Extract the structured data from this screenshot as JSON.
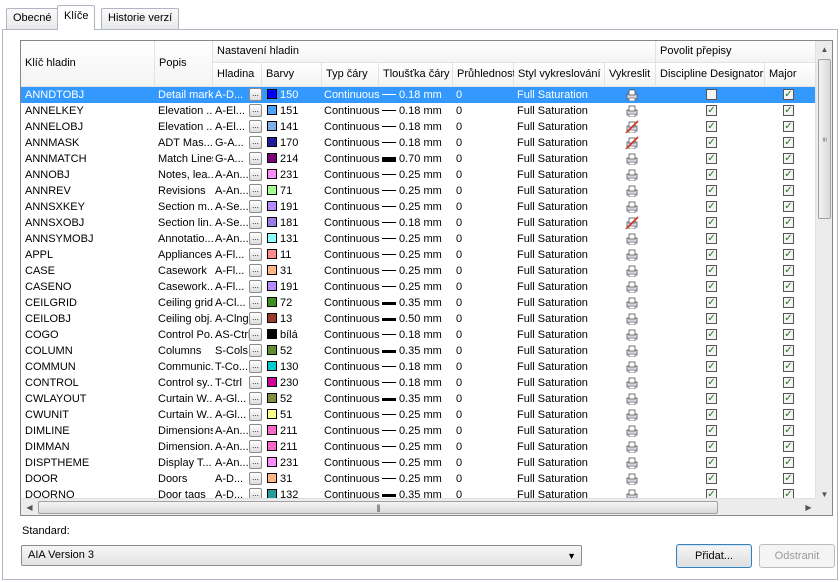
{
  "tabs": [
    "Obecné",
    "Klíče",
    "Historie verzí"
  ],
  "headers": {
    "klic": "Klíč hladin",
    "popis": "Popis",
    "nastaveni": "Nastavení hladin",
    "hladina": "Hladina",
    "barvy": "Barvy",
    "typ": "Typ čáry",
    "tloustka": "Tloušťka čáry",
    "pruhlednost": "Průhlednost",
    "styl": "Styl vykreslování",
    "vykreslit": "Vykreslit",
    "povolit": "Povolit přepisy",
    "discipline": "Discipline Designator",
    "major": "Major"
  },
  "rows": [
    {
      "key": "ANNDTOBJ",
      "popis": "Detail marks",
      "hladina": "A-D...",
      "color_hex": "#0000ff",
      "color": "150",
      "typ": "Continuous",
      "lw": "0.18 mm",
      "lw_style": "thin",
      "pr": "0",
      "styl": "Full Saturation",
      "plot": "yes",
      "disc": false,
      "major": true
    },
    {
      "key": "ANNELKEY",
      "popis": "Elevation ...",
      "hladina": "A-El...",
      "color_hex": "#4aa3ff",
      "color": "151",
      "typ": "Continuous",
      "lw": "0.18 mm",
      "lw_style": "thin",
      "pr": "0",
      "styl": "Full Saturation",
      "plot": "yes",
      "disc": true,
      "major": true
    },
    {
      "key": "ANNELOBJ",
      "popis": "Elevation ...",
      "hladina": "A-El...",
      "color_hex": "#7fb2e6",
      "color": "141",
      "typ": "Continuous",
      "lw": "0.18 mm",
      "lw_style": "thin",
      "pr": "0",
      "styl": "Full Saturation",
      "plot": "no",
      "disc": true,
      "major": true
    },
    {
      "key": "ANNMASK",
      "popis": "ADT Mas...",
      "hladina": "G-A...",
      "color_hex": "#1c1c9c",
      "color": "170",
      "typ": "Continuous",
      "lw": "0.18 mm",
      "lw_style": "thin",
      "pr": "0",
      "styl": "Full Saturation",
      "plot": "no",
      "disc": true,
      "major": true
    },
    {
      "key": "ANNMATCH",
      "popis": "Match Lines",
      "hladina": "G-A...",
      "color_hex": "#7a007a",
      "color": "214",
      "typ": "Continuous",
      "lw": "0.70 mm",
      "lw_style": "thick",
      "pr": "0",
      "styl": "Full Saturation",
      "plot": "yes",
      "disc": true,
      "major": true
    },
    {
      "key": "ANNOBJ",
      "popis": "Notes, lea...",
      "hladina": "A-An...",
      "color_hex": "#ff8cff",
      "color": "231",
      "typ": "Continuous",
      "lw": "0.25 mm",
      "lw_style": "thin",
      "pr": "0",
      "styl": "Full Saturation",
      "plot": "yes",
      "disc": true,
      "major": true
    },
    {
      "key": "ANNREV",
      "popis": "Revisions",
      "hladina": "A-An...",
      "color_hex": "#a8ff8c",
      "color": "71",
      "typ": "Continuous",
      "lw": "0.25 mm",
      "lw_style": "thin",
      "pr": "0",
      "styl": "Full Saturation",
      "plot": "yes",
      "disc": true,
      "major": true
    },
    {
      "key": "ANNSXKEY",
      "popis": "Section m...",
      "hladina": "A-Se...",
      "color_hex": "#b58cff",
      "color": "191",
      "typ": "Continuous",
      "lw": "0.25 mm",
      "lw_style": "thin",
      "pr": "0",
      "styl": "Full Saturation",
      "plot": "yes",
      "disc": true,
      "major": true
    },
    {
      "key": "ANNSXOBJ",
      "popis": "Section lin...",
      "hladina": "A-Se...",
      "color_hex": "#9a7ae6",
      "color": "181",
      "typ": "Continuous",
      "lw": "0.18 mm",
      "lw_style": "thin",
      "pr": "0",
      "styl": "Full Saturation",
      "plot": "no",
      "disc": true,
      "major": true
    },
    {
      "key": "ANNSYMOBJ",
      "popis": "Annotatio...",
      "hladina": "A-An...",
      "color_hex": "#8cffff",
      "color": "131",
      "typ": "Continuous",
      "lw": "0.25 mm",
      "lw_style": "thin",
      "pr": "0",
      "styl": "Full Saturation",
      "plot": "yes",
      "disc": true,
      "major": true
    },
    {
      "key": "APPL",
      "popis": "Appliances",
      "hladina": "A-Fl...",
      "color_hex": "#ff8c8c",
      "color": "11",
      "typ": "Continuous",
      "lw": "0.25 mm",
      "lw_style": "thin",
      "pr": "0",
      "styl": "Full Saturation",
      "plot": "yes",
      "disc": true,
      "major": true
    },
    {
      "key": "CASE",
      "popis": "Casework",
      "hladina": "A-Fl...",
      "color_hex": "#ffb48c",
      "color": "31",
      "typ": "Continuous",
      "lw": "0.25 mm",
      "lw_style": "thin",
      "pr": "0",
      "styl": "Full Saturation",
      "plot": "yes",
      "disc": true,
      "major": true
    },
    {
      "key": "CASENO",
      "popis": "Casework...",
      "hladina": "A-Fl...",
      "color_hex": "#b58cff",
      "color": "191",
      "typ": "Continuous",
      "lw": "0.25 mm",
      "lw_style": "thin",
      "pr": "0",
      "styl": "Full Saturation",
      "plot": "yes",
      "disc": true,
      "major": true
    },
    {
      "key": "CEILGRID",
      "popis": "Ceiling grids",
      "hladina": "A-Cl...",
      "color_hex": "#3f8f1f",
      "color": "72",
      "typ": "Continuous",
      "lw": "0.35 mm",
      "lw_style": "med",
      "pr": "0",
      "styl": "Full Saturation",
      "plot": "yes",
      "disc": true,
      "major": true
    },
    {
      "key": "CEILOBJ",
      "popis": "Ceiling obj...",
      "hladina": "A-Clng",
      "color_hex": "#9c3a2a",
      "color": "13",
      "typ": "Continuous",
      "lw": "0.50 mm",
      "lw_style": "med",
      "pr": "0",
      "styl": "Full Saturation",
      "plot": "yes",
      "disc": true,
      "major": true
    },
    {
      "key": "COGO",
      "popis": "Control Po...",
      "hladina": "AS-Ctrl",
      "color_hex": "#000000",
      "color": "bílá",
      "typ": "Continuous",
      "lw": "0.18 mm",
      "lw_style": "thin",
      "pr": "0",
      "styl": "Full Saturation",
      "plot": "yes",
      "disc": true,
      "major": true
    },
    {
      "key": "COLUMN",
      "popis": "Columns",
      "hladina": "S-Cols",
      "color_hex": "#5f8f2f",
      "color": "52",
      "typ": "Continuous",
      "lw": "0.35 mm",
      "lw_style": "med",
      "pr": "0",
      "styl": "Full Saturation",
      "plot": "yes",
      "disc": true,
      "major": true
    },
    {
      "key": "COMMUN",
      "popis": "Communic...",
      "hladina": "T-Co...",
      "color_hex": "#00cccc",
      "color": "130",
      "typ": "Continuous",
      "lw": "0.18 mm",
      "lw_style": "thin",
      "pr": "0",
      "styl": "Full Saturation",
      "plot": "yes",
      "disc": true,
      "major": true
    },
    {
      "key": "CONTROL",
      "popis": "Control sy...",
      "hladina": "T-Ctrl",
      "color_hex": "#cc0099",
      "color": "230",
      "typ": "Continuous",
      "lw": "0.18 mm",
      "lw_style": "thin",
      "pr": "0",
      "styl": "Full Saturation",
      "plot": "yes",
      "disc": true,
      "major": true
    },
    {
      "key": "CWLAYOUT",
      "popis": "Curtain W...",
      "hladina": "A-Gl...",
      "color_hex": "#7f8f3f",
      "color": "52",
      "typ": "Continuous",
      "lw": "0.35 mm",
      "lw_style": "med",
      "pr": "0",
      "styl": "Full Saturation",
      "plot": "yes",
      "disc": true,
      "major": true
    },
    {
      "key": "CWUNIT",
      "popis": "Curtain W...",
      "hladina": "A-Gl...",
      "color_hex": "#ffff8c",
      "color": "51",
      "typ": "Continuous",
      "lw": "0.25 mm",
      "lw_style": "thin",
      "pr": "0",
      "styl": "Full Saturation",
      "plot": "yes",
      "disc": true,
      "major": true
    },
    {
      "key": "DIMLINE",
      "popis": "Dimensions",
      "hladina": "A-An...",
      "color_hex": "#ff66cc",
      "color": "211",
      "typ": "Continuous",
      "lw": "0.25 mm",
      "lw_style": "thin",
      "pr": "0",
      "styl": "Full Saturation",
      "plot": "yes",
      "disc": true,
      "major": true
    },
    {
      "key": "DIMMAN",
      "popis": "Dimension...",
      "hladina": "A-An...",
      "color_hex": "#ff66cc",
      "color": "211",
      "typ": "Continuous",
      "lw": "0.25 mm",
      "lw_style": "thin",
      "pr": "0",
      "styl": "Full Saturation",
      "plot": "yes",
      "disc": true,
      "major": true
    },
    {
      "key": "DISPTHEME",
      "popis": "Display T...",
      "hladina": "A-An...",
      "color_hex": "#ff8cff",
      "color": "231",
      "typ": "Continuous",
      "lw": "0.25 mm",
      "lw_style": "thin",
      "pr": "0",
      "styl": "Full Saturation",
      "plot": "yes",
      "disc": true,
      "major": true
    },
    {
      "key": "DOOR",
      "popis": "Doors",
      "hladina": "A-D...",
      "color_hex": "#ffb48c",
      "color": "31",
      "typ": "Continuous",
      "lw": "0.25 mm",
      "lw_style": "thin",
      "pr": "0",
      "styl": "Full Saturation",
      "plot": "yes",
      "disc": true,
      "major": true
    },
    {
      "key": "DOORNO",
      "popis": "Door tags",
      "hladina": "A-D...",
      "color_hex": "#2a9c9c",
      "color": "132",
      "typ": "Continuous",
      "lw": "0.35 mm",
      "lw_style": "med",
      "pr": "0",
      "styl": "Full Saturation",
      "plot": "yes",
      "disc": true,
      "major": true
    }
  ],
  "selected_row": 0,
  "standard": {
    "label": "Standard:",
    "value": "AIA Version 3"
  },
  "buttons": {
    "add": "Přidat...",
    "remove": "Odstranit"
  }
}
